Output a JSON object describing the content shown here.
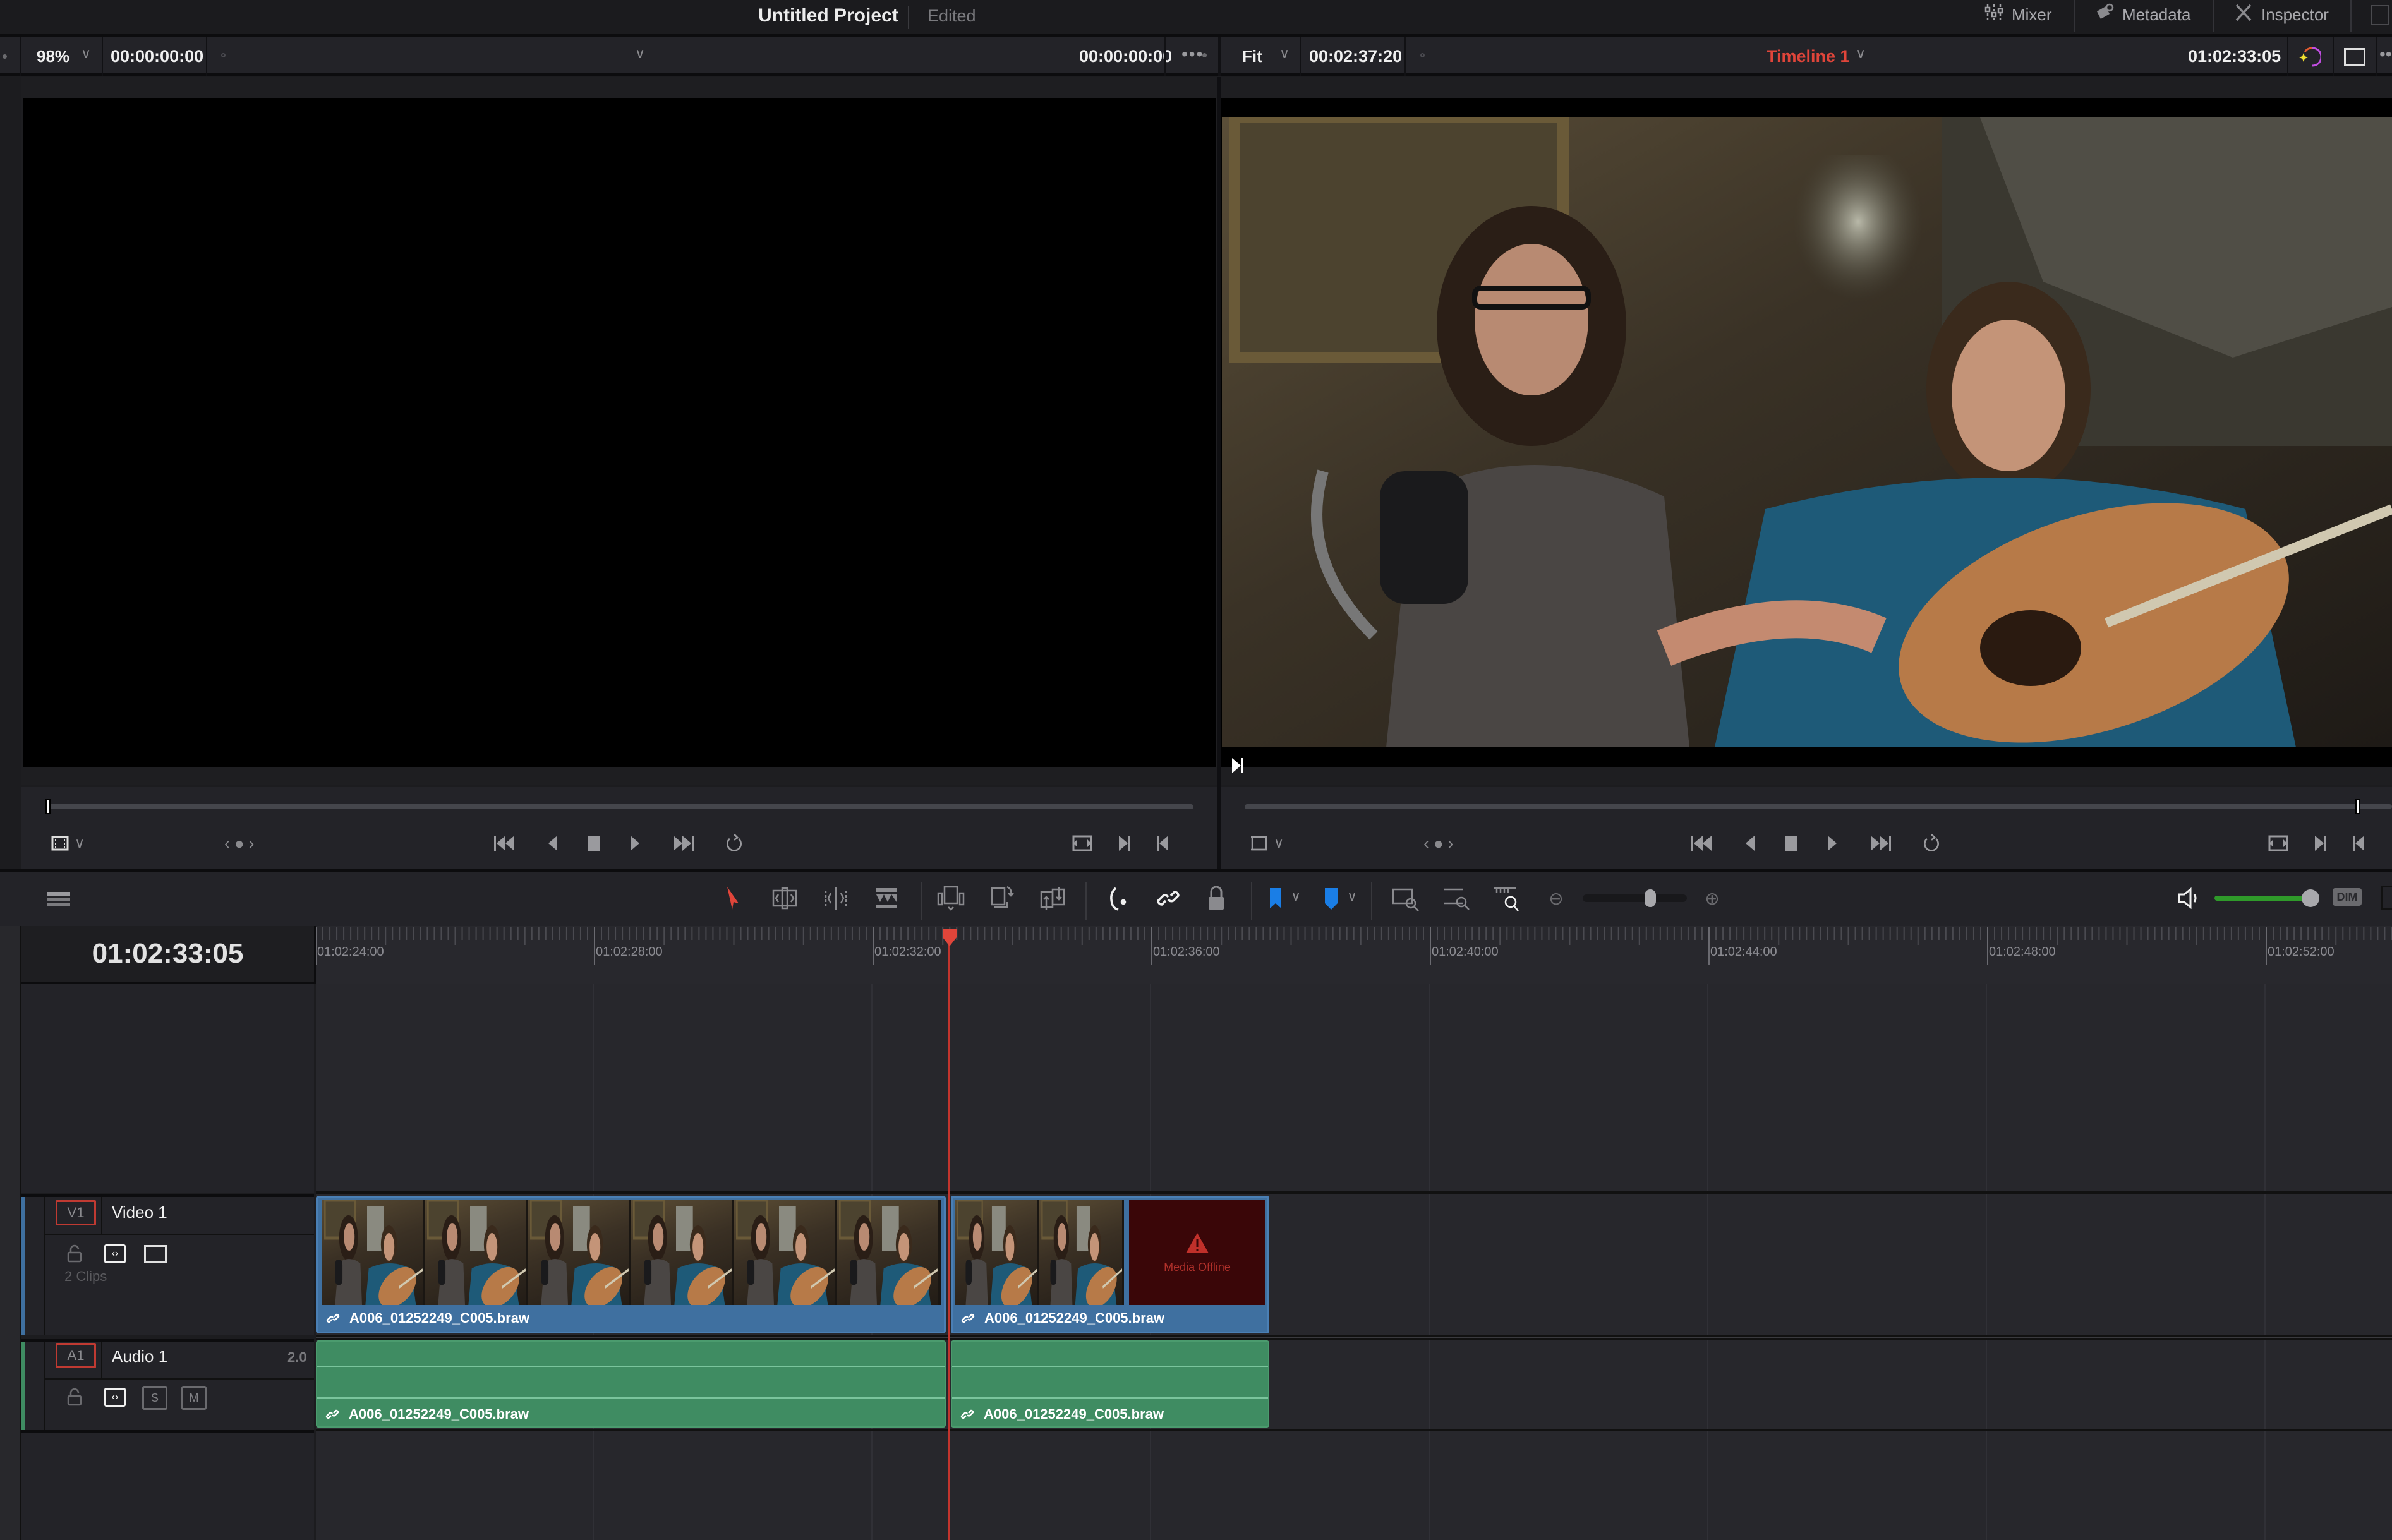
{
  "title_bar": {
    "project_title": "Untitled Project",
    "status": "Edited",
    "buttons": [
      {
        "label": "Mixer",
        "icon": "mixer-icon"
      },
      {
        "label": "Metadata",
        "icon": "metadata-icon"
      },
      {
        "label": "Inspector",
        "icon": "inspector-icon"
      }
    ]
  },
  "source_viewer": {
    "zoom": "98%",
    "timecode_left": "00:00:00:00",
    "timecode_right": "00:00:00:00",
    "scrub_position": 0.0
  },
  "timeline_viewer": {
    "zoom": "Fit",
    "duration": "00:02:37:20",
    "timeline_name": "Timeline 1",
    "timecode": "01:02:33:05",
    "scrub_position": 0.98
  },
  "timeline": {
    "current_timecode": "01:02:33:05",
    "ruler_labels": [
      "01:02:24:00",
      "01:02:28:00",
      "01:02:32:00",
      "01:02:36:00",
      "01:02:40:00",
      "01:02:44:00",
      "01:02:48:00",
      "01:02:52:00"
    ],
    "volume_level": 0.95,
    "dim_label": "DIM",
    "zoom_level": 0.65,
    "tracks": {
      "video": {
        "tag": "V1",
        "name": "Video 1",
        "clip_count": "2 Clips",
        "clips": [
          {
            "name": "A006_01252249_C005.braw"
          },
          {
            "name": "A006_01252249_C005.braw",
            "offline_label": "Media Offline"
          }
        ]
      },
      "audio": {
        "tag": "A1",
        "name": "Audio 1",
        "channels": "2.0",
        "solo": "S",
        "mute": "M",
        "clips": [
          {
            "name": "A006_01252249_C005.braw"
          },
          {
            "name": "A006_01252249_C005.braw"
          }
        ]
      }
    }
  },
  "colors": {
    "accent_red": "#e0453a",
    "video_clip": "#3f70a0",
    "audio_clip": "#3f8c62",
    "marker_blue": "#1a7ee6",
    "volume_green": "#2f9a2a"
  }
}
